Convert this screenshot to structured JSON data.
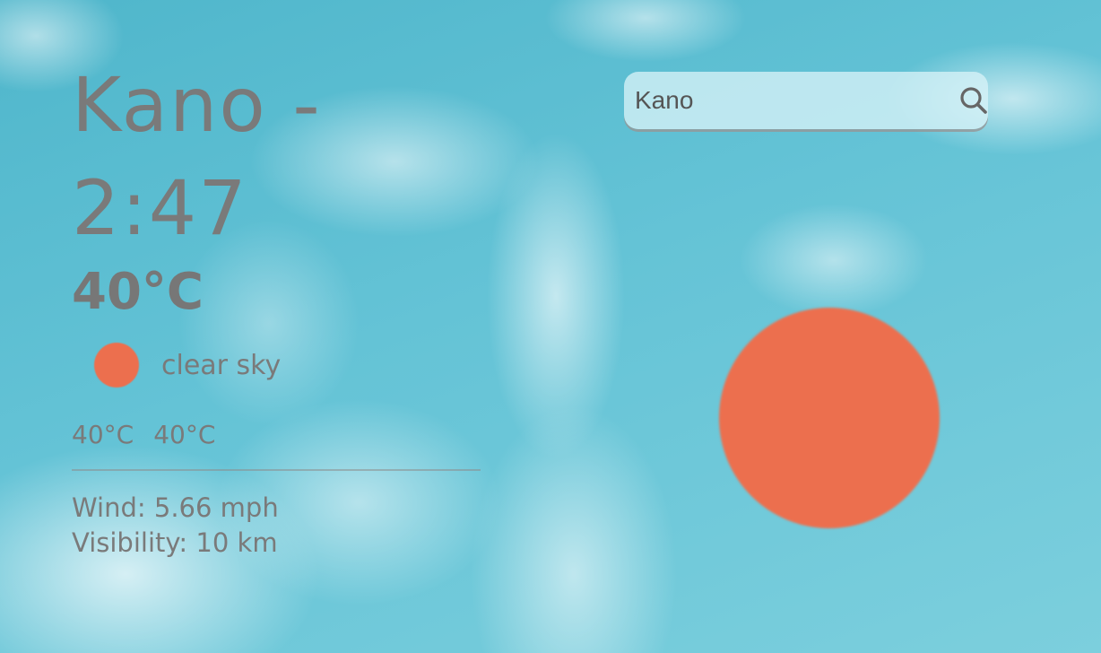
{
  "weather": {
    "city": "Kano",
    "separator": "-",
    "time": "2:47",
    "temperature": "40°C",
    "condition": "clear sky",
    "temp_min": "40°C",
    "temp_max": "40°C",
    "wind": "Wind: 5.66 mph",
    "visibility": "Visibility: 10 km"
  },
  "search": {
    "value": "Kano"
  },
  "icons": {
    "condition_icon": "sun-icon",
    "large_icon": "sun-icon",
    "search_icon": "search-icon"
  },
  "colors": {
    "sun": "#ec6f4e",
    "text": "#7a7a7a",
    "sky": "#5ec0d4"
  }
}
